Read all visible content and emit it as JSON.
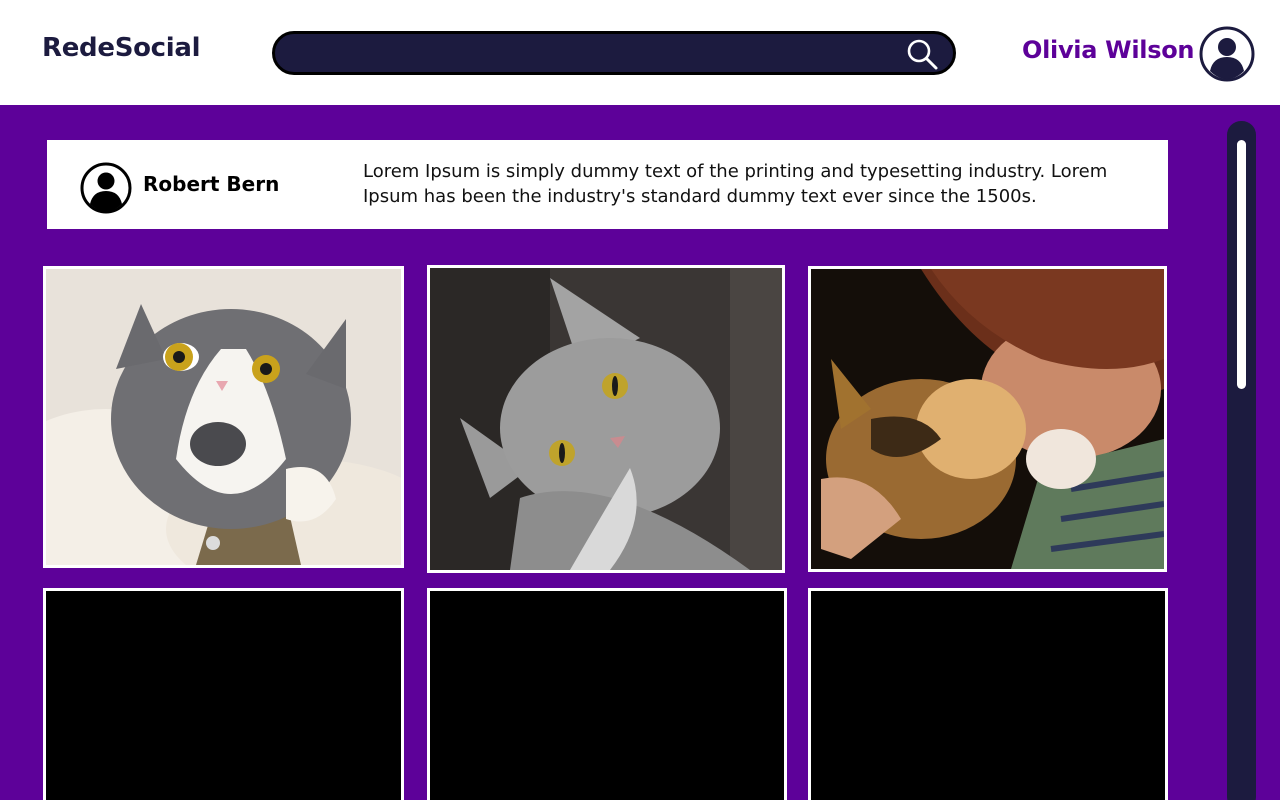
{
  "header": {
    "logo": "RedeSocial",
    "search_value": "",
    "user_name": "Olivia Wilson",
    "icons": [
      "search-icon",
      "user-avatar-icon"
    ]
  },
  "post": {
    "author": "Robert Bern",
    "text": "Lorem Ipsum is simply dummy text of the printing and typesetting industry. Lorem Ipsum has been the industry's standard dummy text ever since the 1500s."
  },
  "gallery": {
    "photos": [
      {
        "subject": "white and grey cat wide-eyed lying on fleece"
      },
      {
        "subject": "grey tabby cat tilting head"
      },
      {
        "subject": "calico cat hugged by a person in plaid shirt"
      },
      {
        "subject": "black"
      },
      {
        "subject": "black"
      },
      {
        "subject": "black"
      }
    ]
  },
  "colors": {
    "brand_purple": "#5d0199",
    "navy": "#1c1b3f",
    "white": "#ffffff"
  }
}
